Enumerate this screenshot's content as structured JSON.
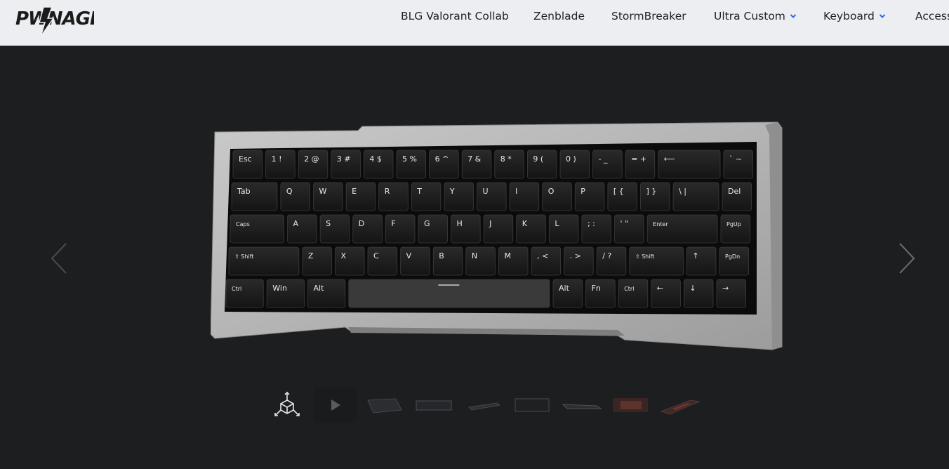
{
  "brand": {
    "logo_text": "PWNAGE"
  },
  "nav": {
    "items": [
      {
        "label": "BLG Valorant Collab",
        "has_dropdown": false
      },
      {
        "label": "Zenblade",
        "has_dropdown": false
      },
      {
        "label": "StormBreaker",
        "has_dropdown": false
      },
      {
        "label": "Ultra Custom",
        "has_dropdown": true
      },
      {
        "label": "Keyboard",
        "has_dropdown": true
      },
      {
        "label": "Access",
        "has_dropdown": false
      }
    ],
    "accent_color": "#2a6df4"
  },
  "gallery": {
    "prev_icon": "chevron-left-icon",
    "next_icon": "chevron-right-icon",
    "thumbnails": [
      {
        "type": "3d-view",
        "icon": "3d-cube-icon"
      },
      {
        "type": "video",
        "icon": "play-icon"
      },
      {
        "type": "image",
        "icon": "keyboard-angle-icon"
      },
      {
        "type": "image",
        "icon": "keyboard-front-icon"
      },
      {
        "type": "image",
        "icon": "keyboard-side-icon"
      },
      {
        "type": "image",
        "icon": "keyboard-top-icon"
      },
      {
        "type": "image",
        "icon": "keyboard-low-icon"
      },
      {
        "type": "image",
        "icon": "keyboard-red-icon"
      },
      {
        "type": "image",
        "icon": "keyboard-red-angle-icon"
      }
    ]
  },
  "keyboard": {
    "rows": [
      [
        "Esc",
        "1 !",
        "2 @",
        "3 #",
        "4 $",
        "5 %",
        "6 ^",
        "7 &",
        "8 *",
        "9 (",
        "0 )",
        "- _",
        "= +",
        "⟵",
        "` ~"
      ],
      [
        "Tab",
        "Q",
        "W",
        "E",
        "R",
        "T",
        "Y",
        "U",
        "I",
        "O",
        "P",
        "[ {",
        "] }",
        "\\ |",
        "Del"
      ],
      [
        "Caps",
        "A",
        "S",
        "D",
        "F",
        "G",
        "H",
        "J",
        "K",
        "L",
        "; :",
        "' \"",
        "Enter",
        "PgUp"
      ],
      [
        "⇧ Shift",
        "Z",
        "X",
        "C",
        "V",
        "B",
        "N",
        "M",
        ", <",
        ". >",
        "/ ?",
        "⇧ Shift",
        "↑",
        "PgDn"
      ],
      [
        "Ctrl",
        "Win",
        "Alt",
        "",
        "Alt",
        "Fn",
        "Ctrl",
        "←",
        "↓",
        "→"
      ]
    ]
  }
}
